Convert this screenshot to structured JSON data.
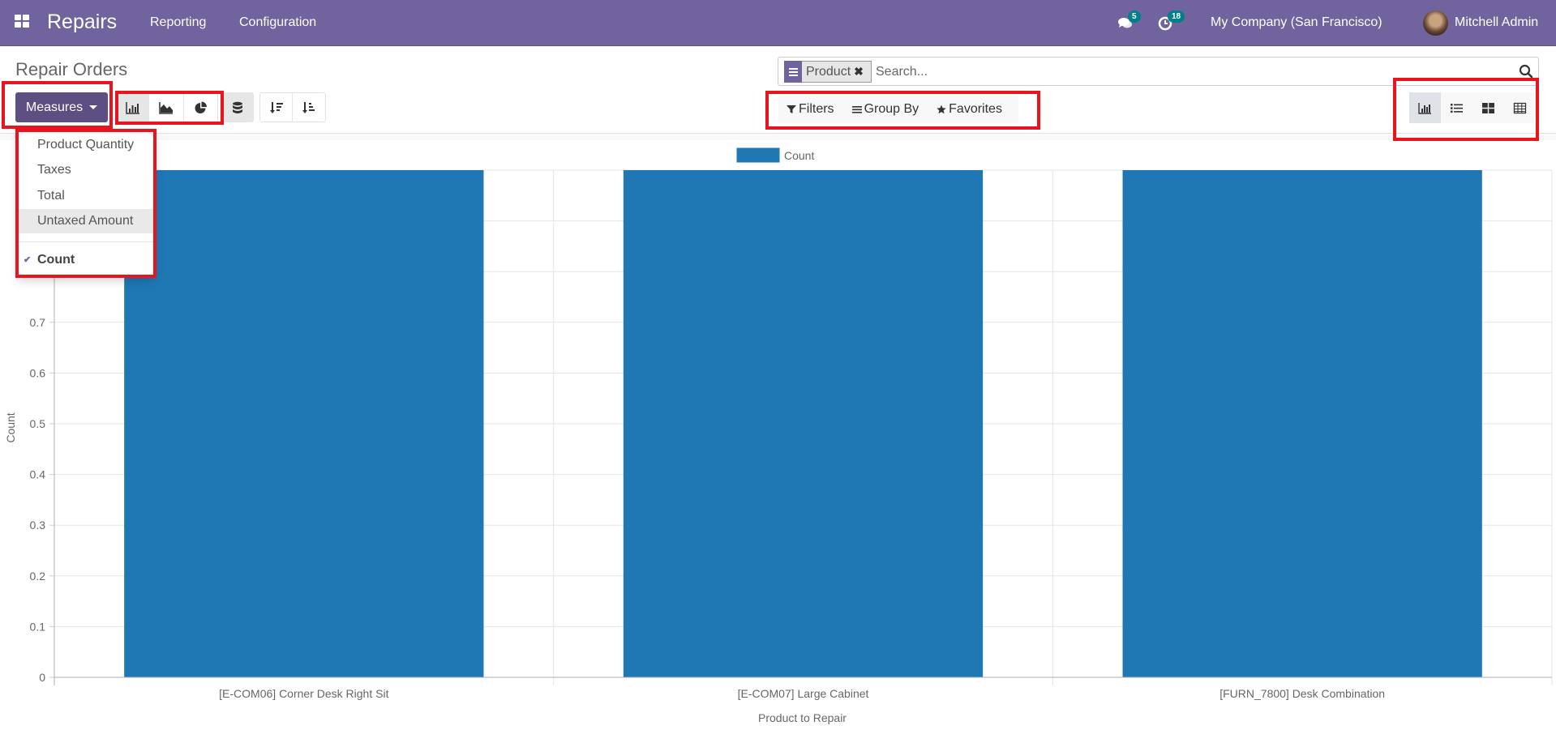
{
  "navbar": {
    "app_name": "Repairs",
    "menu": [
      "Reporting",
      "Configuration"
    ],
    "messages_count": "5",
    "activities_count": "18",
    "company": "My Company (San Francisco)",
    "user": "Mitchell Admin",
    "color": "#71639e"
  },
  "page": {
    "title": "Repair Orders"
  },
  "search": {
    "facet_label": "Product",
    "placeholder": "Search...",
    "value": ""
  },
  "toolbar": {
    "measures_label": "Measures",
    "chart_types": [
      "bar-chart",
      "line-chart",
      "pie-chart"
    ],
    "active_chart_type": "bar-chart",
    "stacked_active": true,
    "sort": [
      "sort-descending",
      "sort-ascending"
    ]
  },
  "filters": {
    "filters_label": "Filters",
    "group_by_label": "Group By",
    "favorites_label": "Favorites"
  },
  "views": {
    "items": [
      "graph",
      "list",
      "kanban",
      "pivot"
    ],
    "active": "graph"
  },
  "measures_menu": {
    "items": [
      {
        "label": "Product Quantity",
        "checked": false
      },
      {
        "label": "Taxes",
        "checked": false
      },
      {
        "label": "Total",
        "checked": false
      },
      {
        "label": "Untaxed Amount",
        "checked": false,
        "hover": true
      }
    ],
    "count_item": {
      "label": "Count",
      "checked": true
    }
  },
  "chart_data": {
    "type": "bar",
    "title": "",
    "categories": [
      "[E-COM06] Corner Desk Right Sit",
      "[E-COM07] Large Cabinet",
      "[FURN_7800] Desk Combination"
    ],
    "series": [
      {
        "name": "Count",
        "values": [
          1,
          1,
          1
        ],
        "color": "#1f77b4"
      }
    ],
    "xlabel": "Product to Repair",
    "ylabel": "Count",
    "ylim": [
      0,
      1
    ],
    "yticks": [
      0,
      0.1,
      0.2,
      0.3,
      0.4,
      0.5,
      0.6,
      0.7,
      0.8,
      0.9,
      1.0
    ],
    "grid": true,
    "legend": "top-center"
  }
}
